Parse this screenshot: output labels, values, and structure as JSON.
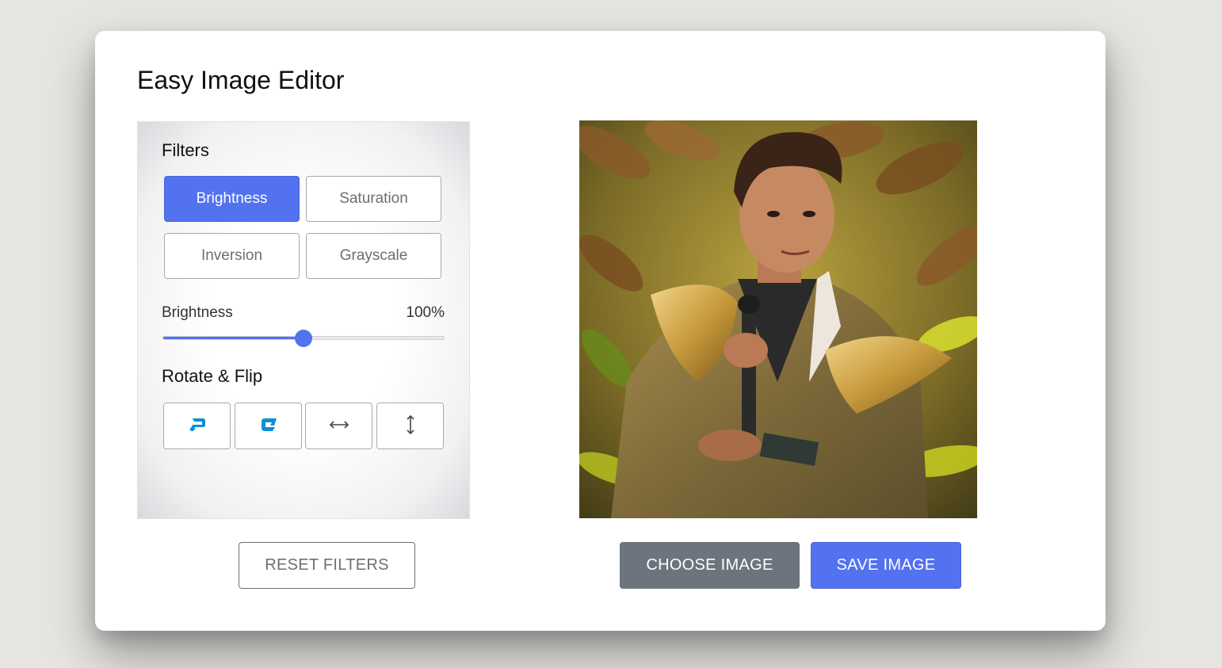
{
  "app": {
    "title": "Easy Image Editor"
  },
  "filters": {
    "heading": "Filters",
    "buttons": [
      {
        "label": "Brightness",
        "active": true
      },
      {
        "label": "Saturation",
        "active": false
      },
      {
        "label": "Inversion",
        "active": false
      },
      {
        "label": "Grayscale",
        "active": false
      }
    ]
  },
  "slider": {
    "label": "Brightness",
    "value_text": "100%",
    "value_fraction": 0.5
  },
  "rotate": {
    "heading": "Rotate & Flip",
    "buttons": [
      {
        "icon": "rotate-left-icon"
      },
      {
        "icon": "rotate-right-icon"
      },
      {
        "icon": "flip-horizontal-icon"
      },
      {
        "icon": "flip-vertical-icon"
      }
    ]
  },
  "actions": {
    "reset_label": "RESET FILTERS",
    "choose_label": "CHOOSE IMAGE",
    "save_label": "SAVE IMAGE"
  },
  "colors": {
    "accent": "#5372f0",
    "secondary": "#6c757d",
    "rotate_icon": "#0b8fd6"
  }
}
